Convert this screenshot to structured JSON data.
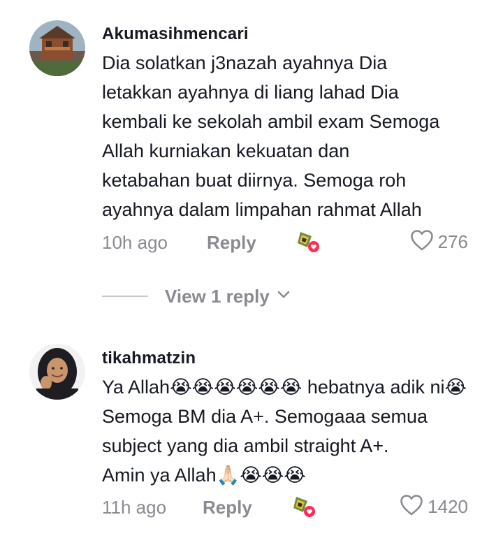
{
  "comments": [
    {
      "username": "Akumasihmencari",
      "lines": [
        "Dia solatkan j3nazah ayahnya Dia",
        "letakkan ayahnya di liang lahad Dia",
        "kembali ke sekolah ambil exam Semoga",
        "Allah kurniakan kekuatan dan",
        "ketabahan buat diirnya. Semoga roh",
        "ayahnya dalam limpahan rahmat Allah"
      ],
      "time": "10h ago",
      "reply_label": "Reply",
      "likes": "276"
    },
    {
      "username": "tikahmatzin",
      "lines": [
        "Ya Allah😭😭😭😭😭😭 hebatnya adik ni😭",
        "Semoga BM dia A+. Semogaaa semua",
        "subject yang dia ambil straight A+.",
        "Amin ya Allah🙏🏻😭😭😭"
      ],
      "time": "11h ago",
      "reply_label": "Reply",
      "likes": "1420"
    }
  ],
  "view_replies_label": "View 1 reply",
  "colors": {
    "text": "#161823",
    "muted": "#8a8b91",
    "gift_heart": "#fe2c55"
  },
  "icons": [
    "heart-outline-icon",
    "gift-heart-icon",
    "chevron-down-icon"
  ]
}
